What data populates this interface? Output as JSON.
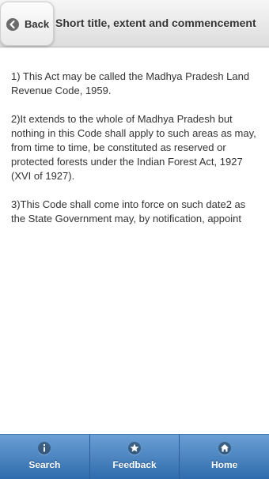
{
  "header": {
    "back_label": "Back",
    "title": "Short title, extent and commencement"
  },
  "content": {
    "paragraphs": [
      "1) This Act may be called the Madhya Pradesh Land Revenue Code, 1959.",
      "2)It extends to the whole of Madhya Pradesh but nothing in this Code shall apply to such areas as may, from time to time, be constituted as reserved or protected forests under the Indian Forest Act, 1927 (XVI of 1927).",
      "3)This Code shall come into force on such date2 as the State Government may, by notification, appoint"
    ]
  },
  "footer": {
    "items": [
      {
        "label": "Search",
        "icon": "info-icon"
      },
      {
        "label": "Feedback",
        "icon": "star-icon"
      },
      {
        "label": "Home",
        "icon": "home-icon"
      }
    ]
  },
  "colors": {
    "footer_bar": "#2f6cad",
    "header_bar": "#e9e9e9",
    "text": "#333333"
  }
}
